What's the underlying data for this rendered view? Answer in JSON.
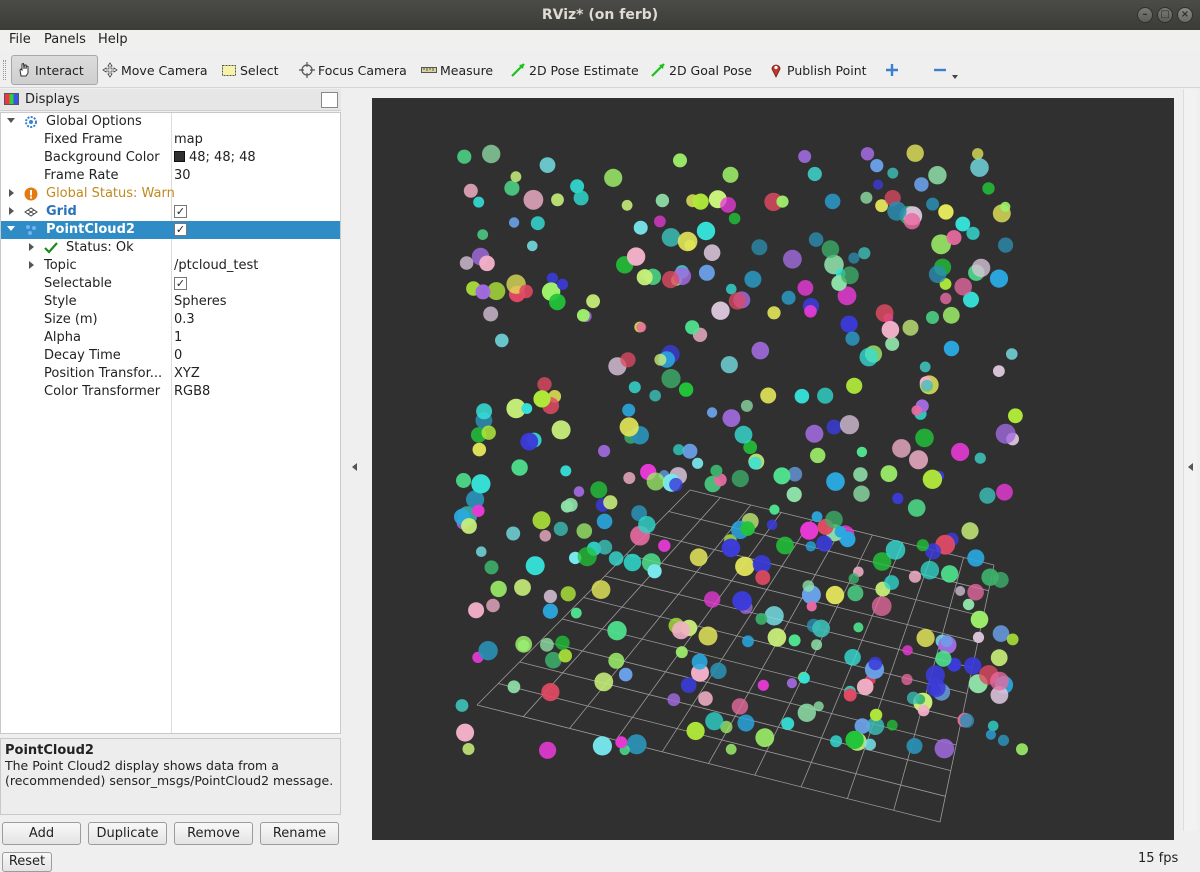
{
  "window": {
    "title": "RViz* (on ferb)"
  },
  "menu": {
    "items": [
      "File",
      "Panels",
      "Help"
    ]
  },
  "toolbar": {
    "interact": "Interact",
    "move_camera": "Move Camera",
    "select": "Select",
    "focus_camera": "Focus Camera",
    "measure": "Measure",
    "pose_estimate": "2D Pose Estimate",
    "goal_pose": "2D Goal Pose",
    "publish_point": "Publish Point"
  },
  "displays": {
    "title": "Displays",
    "global_options": "Global Options",
    "fixed_frame_label": "Fixed Frame",
    "fixed_frame_value": "map",
    "bg_color_label": "Background Color",
    "bg_color_value": "48; 48; 48",
    "frame_rate_label": "Frame Rate",
    "frame_rate_value": "30",
    "global_status": "Global Status: Warn",
    "grid": "Grid",
    "grid_checked": true,
    "pointcloud": "PointCloud2",
    "pointcloud_checked": true,
    "status": "Status: Ok",
    "topic_label": "Topic",
    "topic_value": "/ptcloud_test",
    "selectable_label": "Selectable",
    "selectable_checked": true,
    "style_label": "Style",
    "style_value": "Spheres",
    "size_label": "Size (m)",
    "size_value": "0.3",
    "alpha_label": "Alpha",
    "alpha_value": "1",
    "decay_label": "Decay Time",
    "decay_value": "0",
    "position_label": "Position Transfor...",
    "position_value": "XYZ",
    "color_label": "Color Transformer",
    "color_value": "RGB8"
  },
  "description": {
    "title": "PointCloud2",
    "text": "The Point Cloud2 display shows data from a (recommended) sensor_msgs/PointCloud2 message."
  },
  "buttons": {
    "add": "Add",
    "duplicate": "Duplicate",
    "remove": "Remove",
    "rename": "Rename",
    "reset": "Reset"
  },
  "status": {
    "fps": "15 fps"
  },
  "colors": {
    "background": "#303030",
    "selection": "#308cc6",
    "warn": "#c08a1e",
    "link": "#2a73b9"
  }
}
